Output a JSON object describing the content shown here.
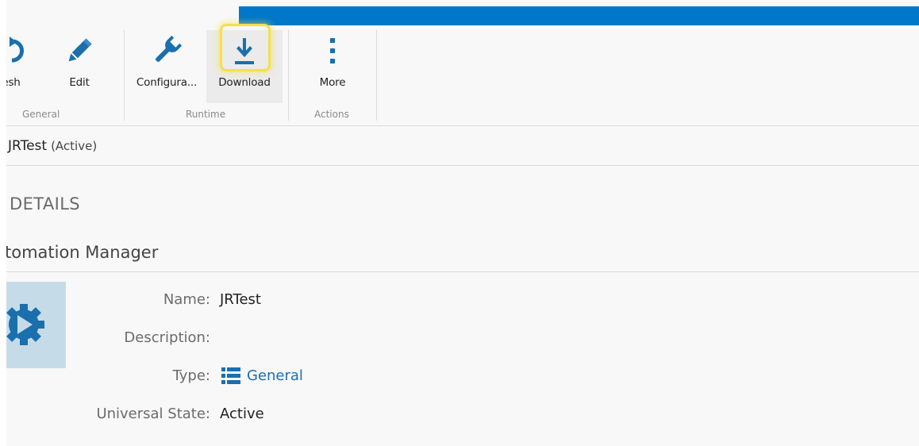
{
  "ribbon": {
    "buttons": {
      "refresh": "esh",
      "edit": "Edit",
      "configure": "Configura...",
      "download": "Download",
      "more": "More"
    },
    "groups": {
      "general": "General",
      "runtime": "Runtime",
      "actions": "Actions"
    }
  },
  "header": {
    "name": "JRTest",
    "status": "(Active)"
  },
  "details": {
    "heading": "DETAILS",
    "section_title": "tomation Manager"
  },
  "properties": {
    "name_label": "Name:",
    "name_value": "JRTest",
    "description_label": "Description:",
    "description_value": "",
    "type_label": "Type:",
    "type_value": "General",
    "state_label": "Universal State:",
    "state_value": "Active"
  },
  "colors": {
    "accent": "#0077c8",
    "icon": "#1a6fad",
    "highlight": "#f4e04a",
    "tile": "#c6dbe8"
  }
}
